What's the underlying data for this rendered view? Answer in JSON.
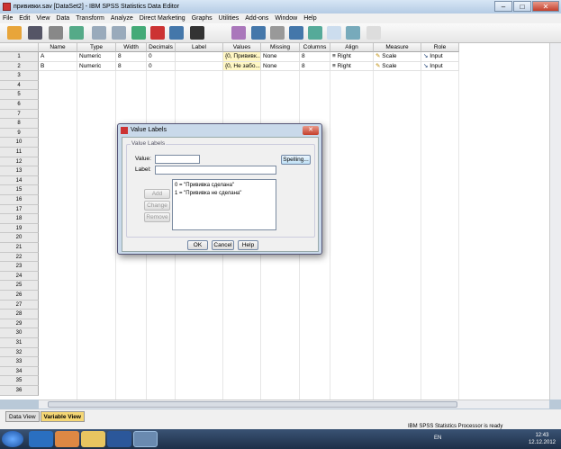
{
  "window": {
    "title": "прививки.sav [DataSet2] - IBM SPSS Statistics Data Editor"
  },
  "menu": [
    "File",
    "Edit",
    "View",
    "Data",
    "Transform",
    "Analyze",
    "Direct Marketing",
    "Graphs",
    "Utilities",
    "Add-ons",
    "Window",
    "Help"
  ],
  "columns": [
    "Name",
    "Type",
    "Width",
    "Decimals",
    "Label",
    "Values",
    "Missing",
    "Columns",
    "Align",
    "Measure",
    "Role"
  ],
  "rows": [
    {
      "num": "1",
      "name": "A",
      "type": "Numeric",
      "width": "8",
      "decimals": "0",
      "label": "",
      "values": "{0, Прививк...",
      "missing": "None",
      "columns": "8",
      "align": "Right",
      "measure": "Scale",
      "role": "Input"
    },
    {
      "num": "2",
      "name": "B",
      "type": "Numeric",
      "width": "8",
      "decimals": "0",
      "label": "",
      "values": "{0, Не забо...",
      "missing": "None",
      "columns": "8",
      "align": "Right",
      "measure": "Scale",
      "role": "Input"
    }
  ],
  "row_numbers": [
    "1",
    "2",
    "3",
    "4",
    "5",
    "6",
    "7",
    "8",
    "9",
    "10",
    "11",
    "12",
    "13",
    "14",
    "15",
    "16",
    "17",
    "18",
    "19",
    "20",
    "21",
    "22",
    "23",
    "24",
    "25",
    "26",
    "27",
    "28",
    "29",
    "30",
    "31",
    "32",
    "33",
    "34",
    "35",
    "36"
  ],
  "tabs": {
    "data_view": "Data View",
    "variable_view": "Variable View"
  },
  "status": "IBM SPSS Statistics Processor is ready",
  "clock": {
    "time": "12:43",
    "date": "12.12.2012"
  },
  "lang": "EN",
  "dialog": {
    "title": "Value Labels",
    "group": "Value Labels",
    "value_label": "Value:",
    "label_label": "Label:",
    "value_input": "",
    "label_input": "",
    "spelling": "Spelling...",
    "add": "Add",
    "change": "Change",
    "remove": "Remove",
    "list": [
      "0 = \"Прививка сделана\"",
      "1 = \"Прививка не сделана\""
    ],
    "ok": "OK",
    "cancel": "Cancel",
    "help": "Help"
  }
}
